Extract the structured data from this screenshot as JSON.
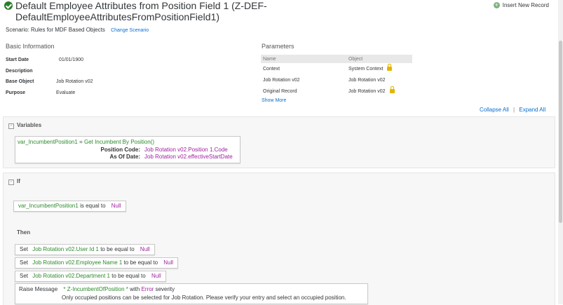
{
  "header": {
    "title": "Default Employee Attributes from Position Field 1 (Z-DEF-DefaultEmployeeAttributesFromPositionField1)",
    "insert_label": "Insert New Record"
  },
  "scenario": {
    "text": "Scenario: Rules for MDF Based Objects",
    "change_label": "Change Scenario"
  },
  "basic_info": {
    "heading": "Basic Information",
    "rows": [
      {
        "label": "Start Date",
        "value": "01/01/1900"
      },
      {
        "label": "Description",
        "value": ""
      },
      {
        "label": "Base Object",
        "value": "Job Rotation v02"
      },
      {
        "label": "Purpose",
        "value": "Evaluate"
      }
    ]
  },
  "parameters": {
    "heading": "Parameters",
    "columns": [
      "Name",
      "Object"
    ],
    "rows": [
      {
        "name": "Context",
        "object": "System Context",
        "locked": true
      },
      {
        "name": "Job Rotation v02",
        "object": "Job Rotation v02",
        "locked": false
      },
      {
        "name": "Original Record",
        "object": "Job Rotation v02",
        "locked": true
      }
    ],
    "show_more": "Show More"
  },
  "controls": {
    "collapse_all": "Collapse All",
    "separator": "|",
    "expand_all": "Expand All"
  },
  "variables": {
    "heading": "Variables",
    "var_name": "var_IncumbentPosition1",
    "eq": "=",
    "func": "Get Incumbent By Position()",
    "param1_label": "Position Code:",
    "param1_value": "Job Rotation v02.Position 1.Code",
    "param2_label": "As Of Date:",
    "param2_value": "Job Rotation v02.effectiveStartDate"
  },
  "if_block": {
    "heading": "If",
    "cond_var": "var_IncumbentPosition1",
    "cond_op": "is equal to",
    "cond_val": "Null",
    "then_label": "Then",
    "actions": [
      {
        "set": "Set",
        "field": "Job Rotation v02.User Id 1",
        "op": "to be equal to",
        "val": "Null"
      },
      {
        "set": "Set",
        "field": "Job Rotation v02.Employee Name 1",
        "op": "to be equal to",
        "val": "Null"
      },
      {
        "set": "Set",
        "field": "Job Rotation v02.Department 1",
        "op": "to be equal to",
        "val": "Null"
      }
    ],
    "raise": {
      "label": "Raise Message",
      "msg": "* Z-IncumbentOfPosition *",
      "with": "with",
      "severity": "Error",
      "severity_suffix": "severity",
      "text": "Only occupied positions can be selected for Job Rotation. Please verify your entry and select an occupied position."
    }
  },
  "colors": {
    "green": "#2b8a2b",
    "purple": "#a020a0",
    "link": "#0a6ed1"
  }
}
